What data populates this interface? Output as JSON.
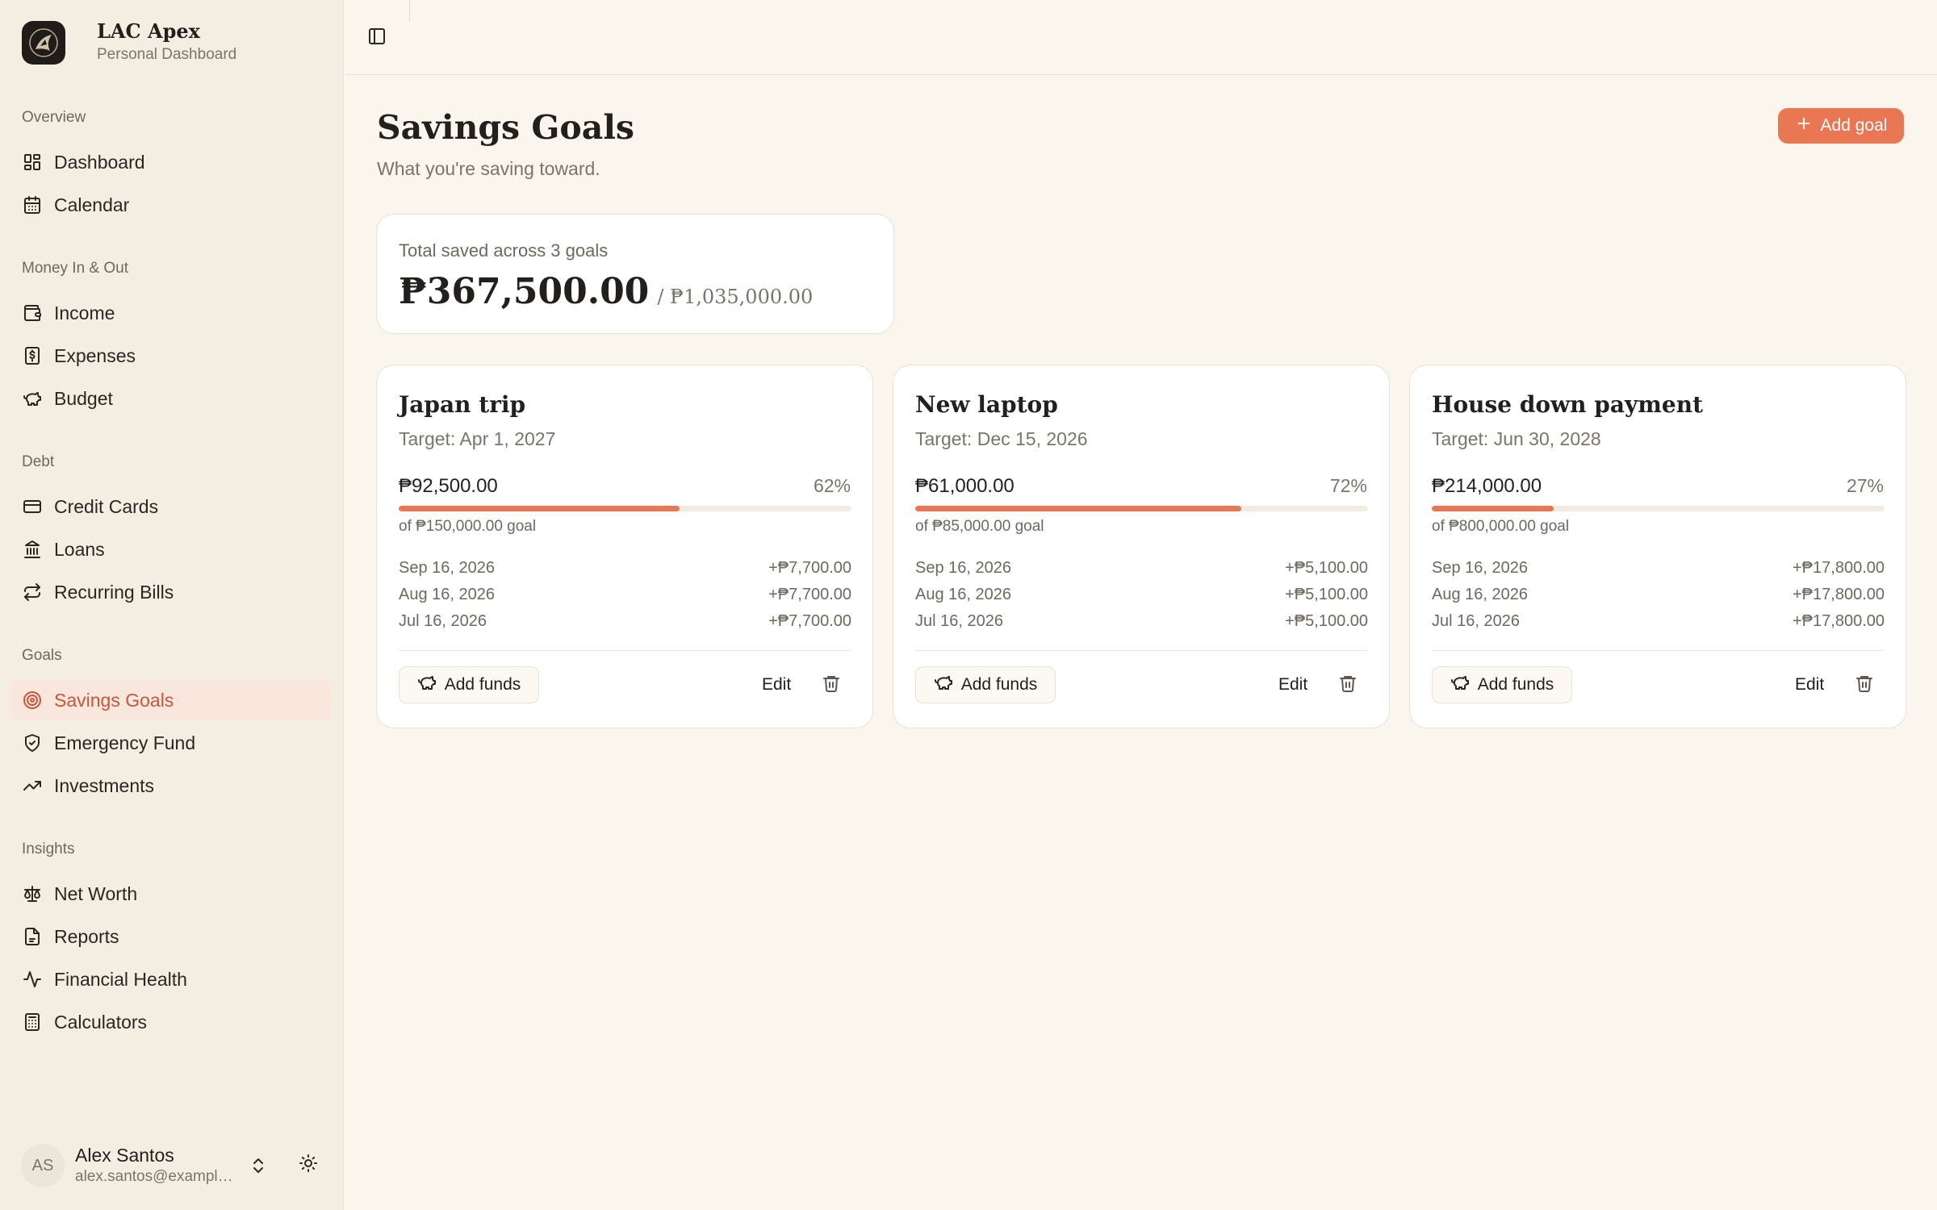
{
  "brand": {
    "name": "LAC Apex",
    "subtitle": "Personal Dashboard"
  },
  "nav": {
    "overview": {
      "label": "Overview",
      "items": [
        {
          "label": "Dashboard",
          "icon": "dashboard-icon"
        },
        {
          "label": "Calendar",
          "icon": "calendar-icon"
        }
      ]
    },
    "money": {
      "label": "Money In & Out",
      "items": [
        {
          "label": "Income",
          "icon": "wallet-icon"
        },
        {
          "label": "Expenses",
          "icon": "receipt-icon"
        },
        {
          "label": "Budget",
          "icon": "piggy-bank-icon"
        }
      ]
    },
    "debt": {
      "label": "Debt",
      "items": [
        {
          "label": "Credit Cards",
          "icon": "credit-card-icon"
        },
        {
          "label": "Loans",
          "icon": "bank-icon"
        },
        {
          "label": "Recurring Bills",
          "icon": "repeat-icon"
        }
      ]
    },
    "goals": {
      "label": "Goals",
      "items": [
        {
          "label": "Savings Goals",
          "icon": "target-icon",
          "active": true
        },
        {
          "label": "Emergency Fund",
          "icon": "shield-icon"
        },
        {
          "label": "Investments",
          "icon": "trending-up-icon"
        }
      ]
    },
    "insights": {
      "label": "Insights",
      "items": [
        {
          "label": "Net Worth",
          "icon": "scale-icon"
        },
        {
          "label": "Reports",
          "icon": "file-icon"
        },
        {
          "label": "Financial Health",
          "icon": "activity-icon"
        },
        {
          "label": "Calculators",
          "icon": "calculator-icon"
        }
      ]
    }
  },
  "user": {
    "initials": "AS",
    "name": "Alex Santos",
    "email": "alex.santos@example.com"
  },
  "page": {
    "title": "Savings Goals",
    "subtitle": "What you're saving toward.",
    "add_goal_label": "Add goal"
  },
  "summary": {
    "label": "Total saved across 3 goals",
    "amount": "₱367,500.00",
    "goal": "/ ₱1,035,000.00"
  },
  "goals": [
    {
      "name": "Japan trip",
      "target": "Target: Apr 1, 2027",
      "saved": "₱92,500.00",
      "percent_label": "62%",
      "progress": 0.62,
      "of_goal": "of ₱150,000.00 goal",
      "contributions": [
        {
          "date": "Sep 16, 2026",
          "amount": "+₱7,700.00"
        },
        {
          "date": "Aug 16, 2026",
          "amount": "+₱7,700.00"
        },
        {
          "date": "Jul 16, 2026",
          "amount": "+₱7,700.00"
        }
      ],
      "add_funds_label": "Add funds",
      "edit_label": "Edit"
    },
    {
      "name": "New laptop",
      "target": "Target: Dec 15, 2026",
      "saved": "₱61,000.00",
      "percent_label": "72%",
      "progress": 0.72,
      "of_goal": "of ₱85,000.00 goal",
      "contributions": [
        {
          "date": "Sep 16, 2026",
          "amount": "+₱5,100.00"
        },
        {
          "date": "Aug 16, 2026",
          "amount": "+₱5,100.00"
        },
        {
          "date": "Jul 16, 2026",
          "amount": "+₱5,100.00"
        }
      ],
      "add_funds_label": "Add funds",
      "edit_label": "Edit"
    },
    {
      "name": "House down payment",
      "target": "Target: Jun 30, 2028",
      "saved": "₱214,000.00",
      "percent_label": "27%",
      "progress": 0.27,
      "of_goal": "of ₱800,000.00 goal",
      "contributions": [
        {
          "date": "Sep 16, 2026",
          "amount": "+₱17,800.00"
        },
        {
          "date": "Aug 16, 2026",
          "amount": "+₱17,800.00"
        },
        {
          "date": "Jul 16, 2026",
          "amount": "+₱17,800.00"
        }
      ],
      "add_funds_label": "Add funds",
      "edit_label": "Edit"
    }
  ],
  "colors": {
    "accent": "#e97754",
    "active_bg": "#f9e6dc",
    "active_text": "#c8563a",
    "background": "#faf6ee",
    "sidebar": "#f3ede2"
  }
}
